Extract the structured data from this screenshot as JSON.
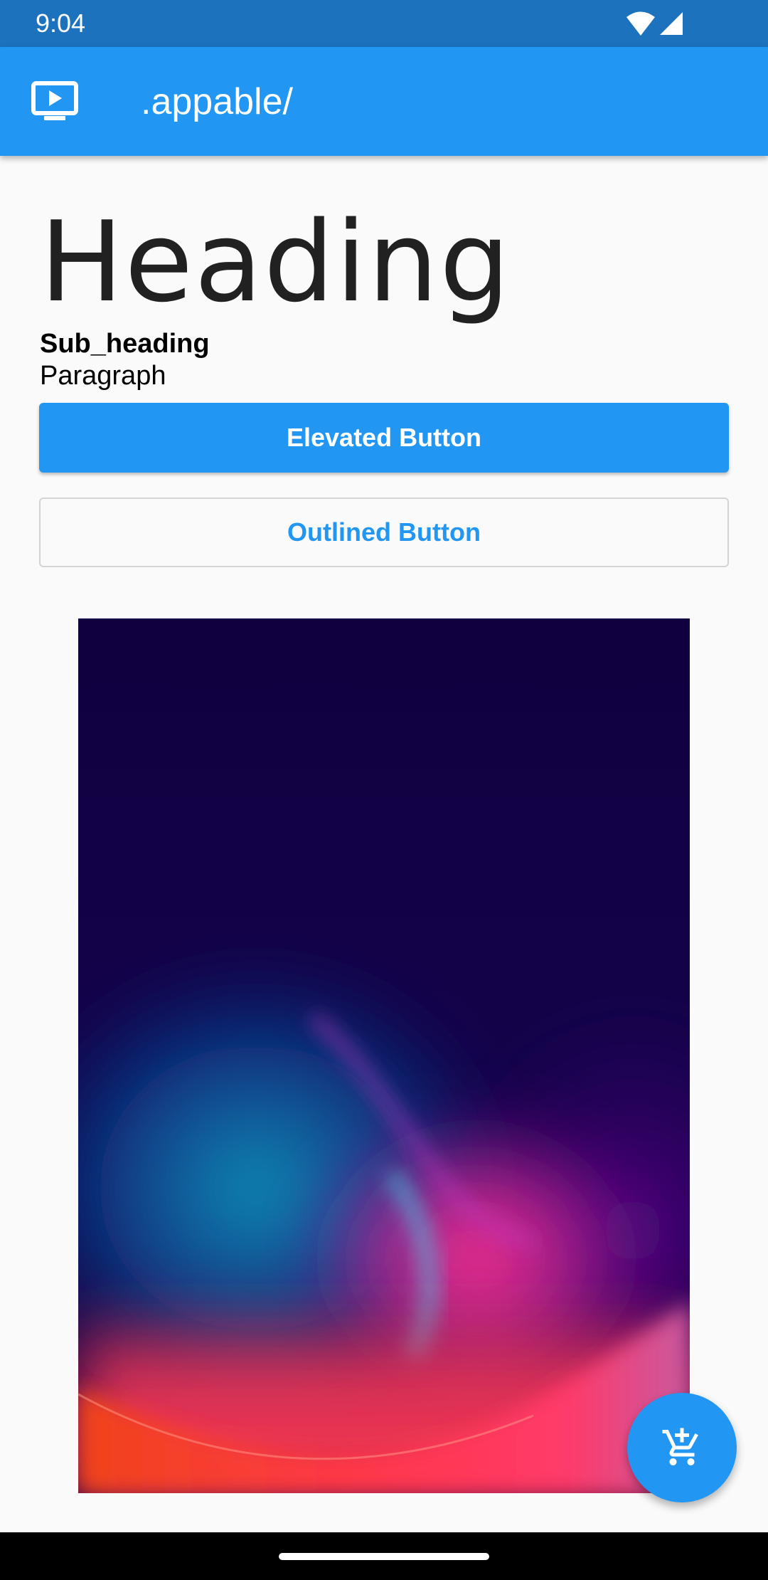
{
  "status_bar": {
    "time": "9:04",
    "icons": [
      "wifi-icon",
      "cellular-signal-icon"
    ]
  },
  "app_bar": {
    "icon": "tv-play-icon",
    "title": ".appable/"
  },
  "content": {
    "heading": "Heading",
    "sub_heading": "Sub_heading",
    "paragraph": "Paragraph",
    "elevated_button_label": "Elevated Button",
    "outlined_button_label": "Outlined Button"
  },
  "fab": {
    "icon": "add-shopping-cart-icon"
  },
  "colors": {
    "primary": "#2196f3",
    "status_bar": "#1c72bd",
    "background": "#fafafa",
    "text": "#212121"
  }
}
